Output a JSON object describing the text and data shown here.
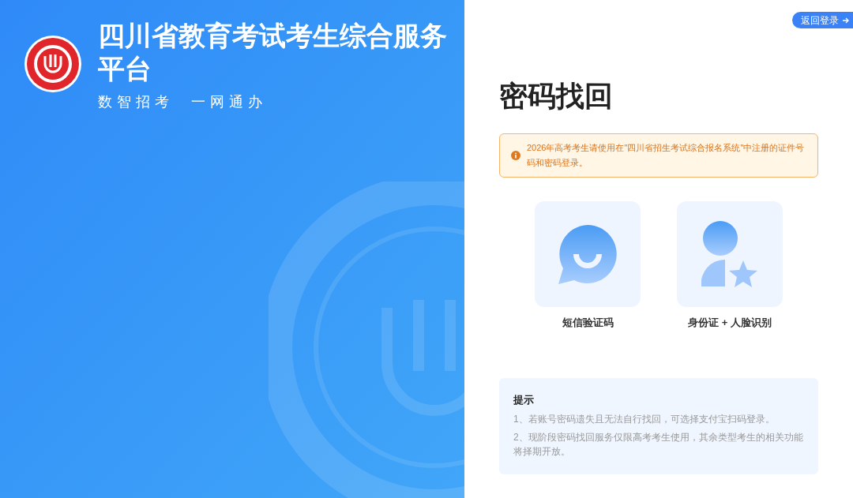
{
  "brand": {
    "title_lines": [
      "四川省教育考试考生综合服务",
      "平台"
    ],
    "slogan": "数智招考  一网通办"
  },
  "back_button": {
    "label": "返回登录"
  },
  "heading": "密码找回",
  "notice": {
    "text": "2026年高考考生请使用在\"四川省招生考试综合报名系统\"中注册的证件号码和密码登录。"
  },
  "methods": [
    {
      "kind": "sms",
      "label": "短信验证码"
    },
    {
      "kind": "face",
      "label": "身份证 + 人脸识别"
    }
  ],
  "tips": {
    "title": "提示",
    "items": [
      "1、若账号密码遗失且无法自行找回，可选择支付宝扫码登录。",
      "2、现阶段密码找回服务仅限高考考生使用，其余类型考生的相关功能将择期开放。"
    ]
  }
}
